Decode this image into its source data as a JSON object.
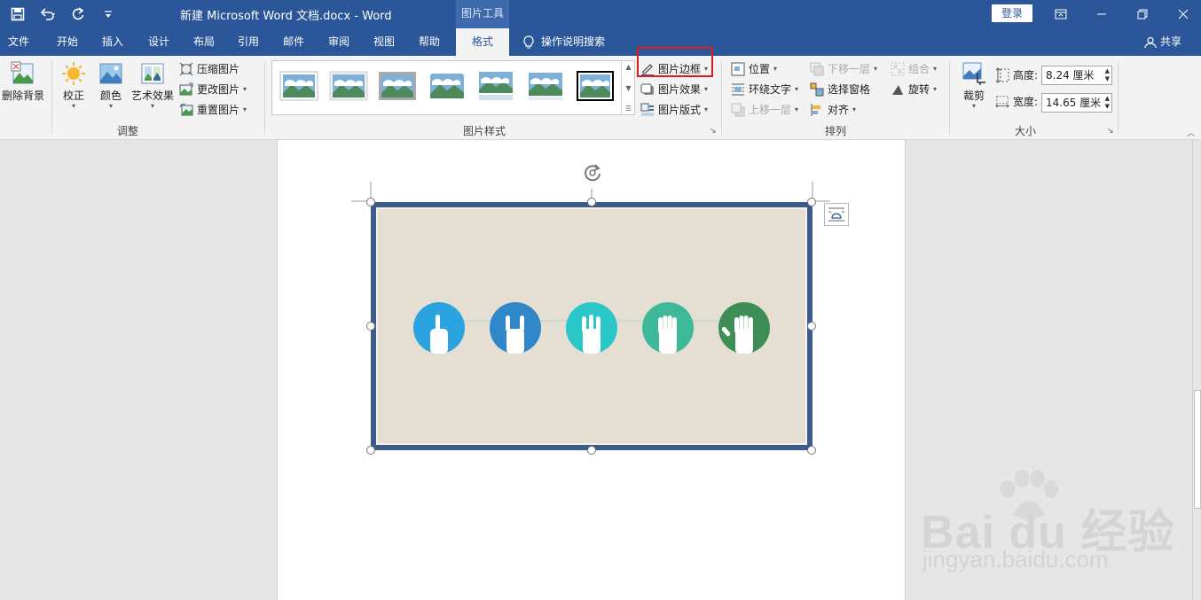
{
  "window": {
    "doc_title": "新建 Microsoft Word 文档.docx  -  Word",
    "context_tab": "图片工具",
    "login_label": "登录",
    "brand_color": "#2b579a"
  },
  "tabs": [
    {
      "label": "文件"
    },
    {
      "label": "开始"
    },
    {
      "label": "插入"
    },
    {
      "label": "设计"
    },
    {
      "label": "布局"
    },
    {
      "label": "引用"
    },
    {
      "label": "邮件"
    },
    {
      "label": "审阅"
    },
    {
      "label": "视图"
    },
    {
      "label": "帮助"
    },
    {
      "label": "格式",
      "active": true
    }
  ],
  "tell_me": "操作说明搜索",
  "share": "共享",
  "ribbon": {
    "adjust": {
      "remove_bg": "删除背景",
      "corrections": "校正",
      "color": "颜色",
      "artistic": "艺术效果",
      "compress": "压缩图片",
      "change": "更改图片",
      "reset": "重置图片",
      "label": "调整"
    },
    "styles": {
      "label": "图片样式",
      "border": "图片边框",
      "effects": "图片效果",
      "layout": "图片版式",
      "highlight_color": "#d81e1e"
    },
    "arrange": {
      "position": "位置",
      "wrap": "环绕文字",
      "forward": "上移一层",
      "backward": "下移一层",
      "selection_pane": "选择窗格",
      "align": "对齐",
      "group": "组合",
      "rotate": "旋转",
      "label": "排列"
    },
    "size": {
      "crop": "裁剪",
      "height_label": "高度:",
      "height_value": "8.24 厘米",
      "width_label": "宽度:",
      "width_value": "14.65 厘米",
      "label": "大小"
    }
  },
  "picture": {
    "hand_colors": [
      "#2aa3e0",
      "#2f86c8",
      "#2bc7c8",
      "#3db99a",
      "#3d8e54"
    ],
    "border_color": "#3c5a8a"
  },
  "watermark": {
    "brand": "Bai du 经验",
    "url": "jingyan.baidu.com"
  }
}
